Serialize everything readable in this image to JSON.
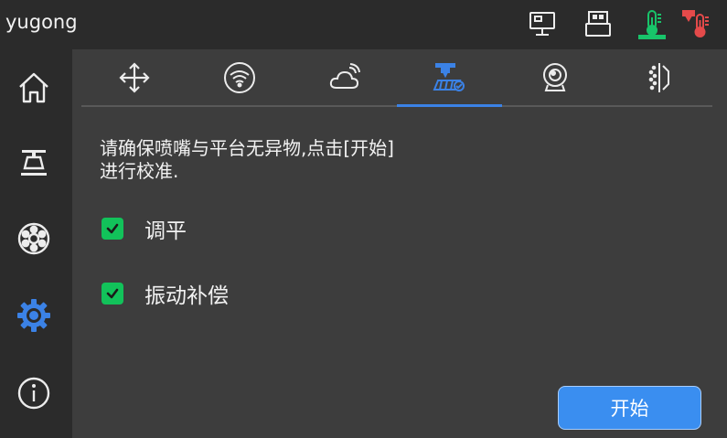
{
  "header": {
    "title": "yugong",
    "status_icons": [
      "network-icon",
      "usb-icon",
      "bed-temperature-icon",
      "nozzle-temperature-icon"
    ],
    "colors": {
      "bed_temp": "#18c46a",
      "nozzle_temp": "#e44a4a"
    }
  },
  "sidebar": {
    "items": [
      "home-icon",
      "print-icon",
      "filament-icon",
      "settings-icon",
      "info-icon"
    ],
    "active": "settings-icon",
    "active_color": "#3b82e6"
  },
  "tabs": {
    "items": [
      "move-icon",
      "wifi-icon",
      "cloud-icon",
      "calibration-icon",
      "camera-icon",
      "light-icon"
    ],
    "active": "calibration-icon"
  },
  "calibration": {
    "message": "请确保喷嘴与平台无异物,点击[开始]\n进行校准.",
    "options": [
      {
        "label": "调平",
        "checked": true
      },
      {
        "label": "振动补偿",
        "checked": true
      }
    ],
    "start_label": "开始"
  },
  "colors": {
    "accent": "#3b82e6",
    "checkbox": "#12c25a",
    "button": "#3a8ef0"
  }
}
